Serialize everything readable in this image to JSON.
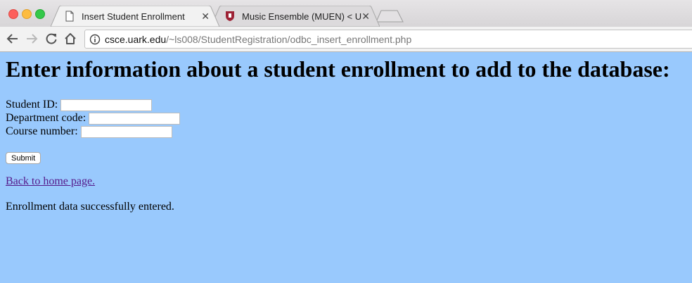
{
  "browser": {
    "tabs": [
      {
        "title": "Insert Student Enrollment",
        "close": "✕",
        "icon": "page-icon"
      },
      {
        "title": "Music Ensemble (MUEN) < Uni",
        "close": "✕",
        "icon": "university-shield-icon"
      }
    ],
    "url": {
      "host": "csce.uark.edu",
      "path": "/~ls008/StudentRegistration/odbc_insert_enrollment.php"
    }
  },
  "page": {
    "heading": "Enter information about a student enrollment to add to the database:",
    "fields": [
      {
        "label": "Student ID:",
        "value": ""
      },
      {
        "label": "Department code:",
        "value": ""
      },
      {
        "label": "Course number:",
        "value": ""
      }
    ],
    "submit_label": "Submit",
    "home_link": "Back to home page.",
    "status_message": "Enrollment data successfully entered."
  },
  "colors": {
    "page_background": "#99c9fd",
    "visited_link": "#551a8b"
  }
}
